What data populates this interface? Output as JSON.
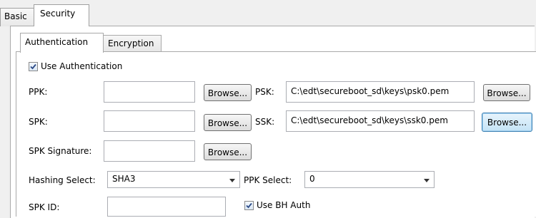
{
  "outer_tabs": [
    "Basic",
    "Security"
  ],
  "inner_tabs": [
    "Authentication",
    "Encryption"
  ],
  "use_authentication": {
    "label": "Use Authentication",
    "checked": true
  },
  "ppk": {
    "label": "PPK:",
    "value": ""
  },
  "psk": {
    "label": "PSK:",
    "value": "C:\\edt\\secureboot_sd\\keys\\psk0.pem"
  },
  "spk": {
    "label": "SPK:",
    "value": ""
  },
  "ssk": {
    "label": "SSK:",
    "value": "C:\\edt\\secureboot_sd\\keys\\ssk0.pem"
  },
  "spk_signature": {
    "label": "SPK Signature:",
    "value": ""
  },
  "browse_label": "Browse...",
  "hashing_select": {
    "label": "Hashing Select:",
    "value": "SHA3"
  },
  "ppk_select": {
    "label": "PPK Select:",
    "value": "0"
  },
  "spk_id": {
    "label": "SPK ID:",
    "value": ""
  },
  "use_bh_auth": {
    "label": "Use BH Auth",
    "checked": true
  }
}
